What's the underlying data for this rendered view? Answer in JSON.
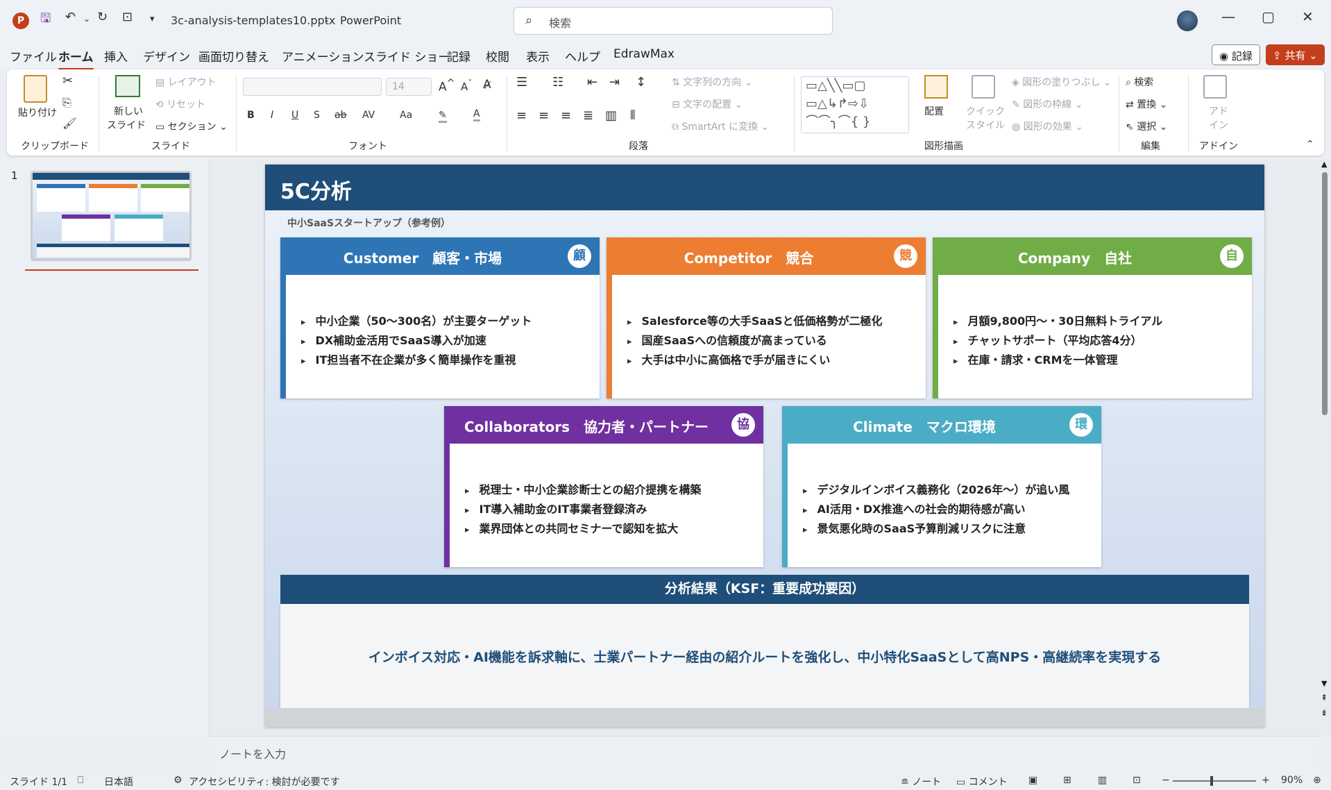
{
  "window": {
    "file_title": "3c-analysis-templates10.pptx",
    "app_name": "PowerPoint",
    "search_placeholder": "検索",
    "minimize": "—",
    "maximize": "▢",
    "close": "✕"
  },
  "menu": {
    "items": [
      "ファイル",
      "ホーム",
      "挿入",
      "デザイン",
      "画面切り替え",
      "アニメーション",
      "スライド ショー",
      "記録",
      "校閲",
      "表示",
      "ヘルプ",
      "EdrawMax"
    ],
    "record_button": "記録",
    "share_button": "共有"
  },
  "ribbon": {
    "clipboard": {
      "paste": "貼り付け",
      "group": "クリップボード"
    },
    "slides": {
      "new_slide_line1": "新しい",
      "new_slide_line2": "スライド",
      "layout": "レイアウト",
      "reset": "リセット",
      "section": "セクション",
      "group": "スライド"
    },
    "font": {
      "size": "14",
      "group": "フォント",
      "bold": "B",
      "italic": "I",
      "underline": "U",
      "shadow": "S",
      "strike": "ab",
      "spacing": "AV",
      "case": "Aa",
      "color": "A"
    },
    "paragraph": {
      "text_direction": "文字列の方向",
      "align_text": "文字の配置",
      "smartart": "SmartArt に変換",
      "group": "段落"
    },
    "drawing": {
      "arrange": "配置",
      "quick_styles_line1": "クイック",
      "quick_styles_line2": "スタイル",
      "shape_fill": "図形の塗りつぶし",
      "shape_outline": "図形の枠線",
      "shape_effects": "図形の効果",
      "group": "図形描画"
    },
    "editing": {
      "find": "検索",
      "replace": "置換",
      "select": "選択",
      "group": "編集"
    },
    "addins": {
      "label_line1": "アド",
      "label_line2": "イン",
      "group": "アドイン"
    }
  },
  "thumbnail": {
    "number": "1"
  },
  "slide": {
    "title": "5C分析",
    "subtitle": "中小SaaSスタートアップ（参考例）",
    "cards": [
      {
        "title": "Customer　顧客・市場",
        "badge": "顧",
        "color": "#2e75b6",
        "bullets": [
          "中小企業（50〜300名）が主要ターゲット",
          "DX補助金活用でSaaS導入が加速",
          "IT担当者不在企業が多く簡単操作を重視"
        ]
      },
      {
        "title": "Competitor　競合",
        "badge": "競",
        "color": "#ed7d31",
        "bullets": [
          "Salesforce等の大手SaaSと低価格勢が二極化",
          "国産SaaSへの信頼度が高まっている",
          "大手は中小に高価格で手が届きにくい"
        ]
      },
      {
        "title": "Company　自社",
        "badge": "自",
        "color": "#70ad47",
        "bullets": [
          "月額9,800円〜・30日無料トライアル",
          "チャットサポート（平均応答4分）",
          "在庫・請求・CRMを一体管理"
        ]
      },
      {
        "title": "Collaborators　協力者・パートナー",
        "badge": "協",
        "color": "#7030a0",
        "bullets": [
          "税理士・中小企業診断士との紹介提携を構築",
          "IT導入補助金のIT事業者登録済み",
          "業界団体との共同セミナーで認知を拡大"
        ]
      },
      {
        "title": "Climate　マクロ環境",
        "badge": "環",
        "color": "#4bacc6",
        "bullets": [
          "デジタルインボイス義務化（2026年〜）が追い風",
          "AI活用・DX推進への社会的期待感が高い",
          "景気悪化時のSaaS予算削減リスクに注意"
        ]
      }
    ],
    "ksf_title": "分析結果（KSF：重要成功要因）",
    "ksf_text": "インボイス対応・AI機能を訴求軸に、士業パートナー経由の紹介ルートを強化し、中小特化SaaSとして高NPS・高継続率を実現する"
  },
  "notes_placeholder": "ノートを入力",
  "status": {
    "slide": "スライド 1/1",
    "language": "日本語",
    "accessibility": "アクセシビリティ: 検討が必要です",
    "notes": "ノート",
    "comments": "コメント",
    "zoom": "90%"
  },
  "colors": {
    "accent": "#c43e1c",
    "header": "#1f4e79"
  }
}
